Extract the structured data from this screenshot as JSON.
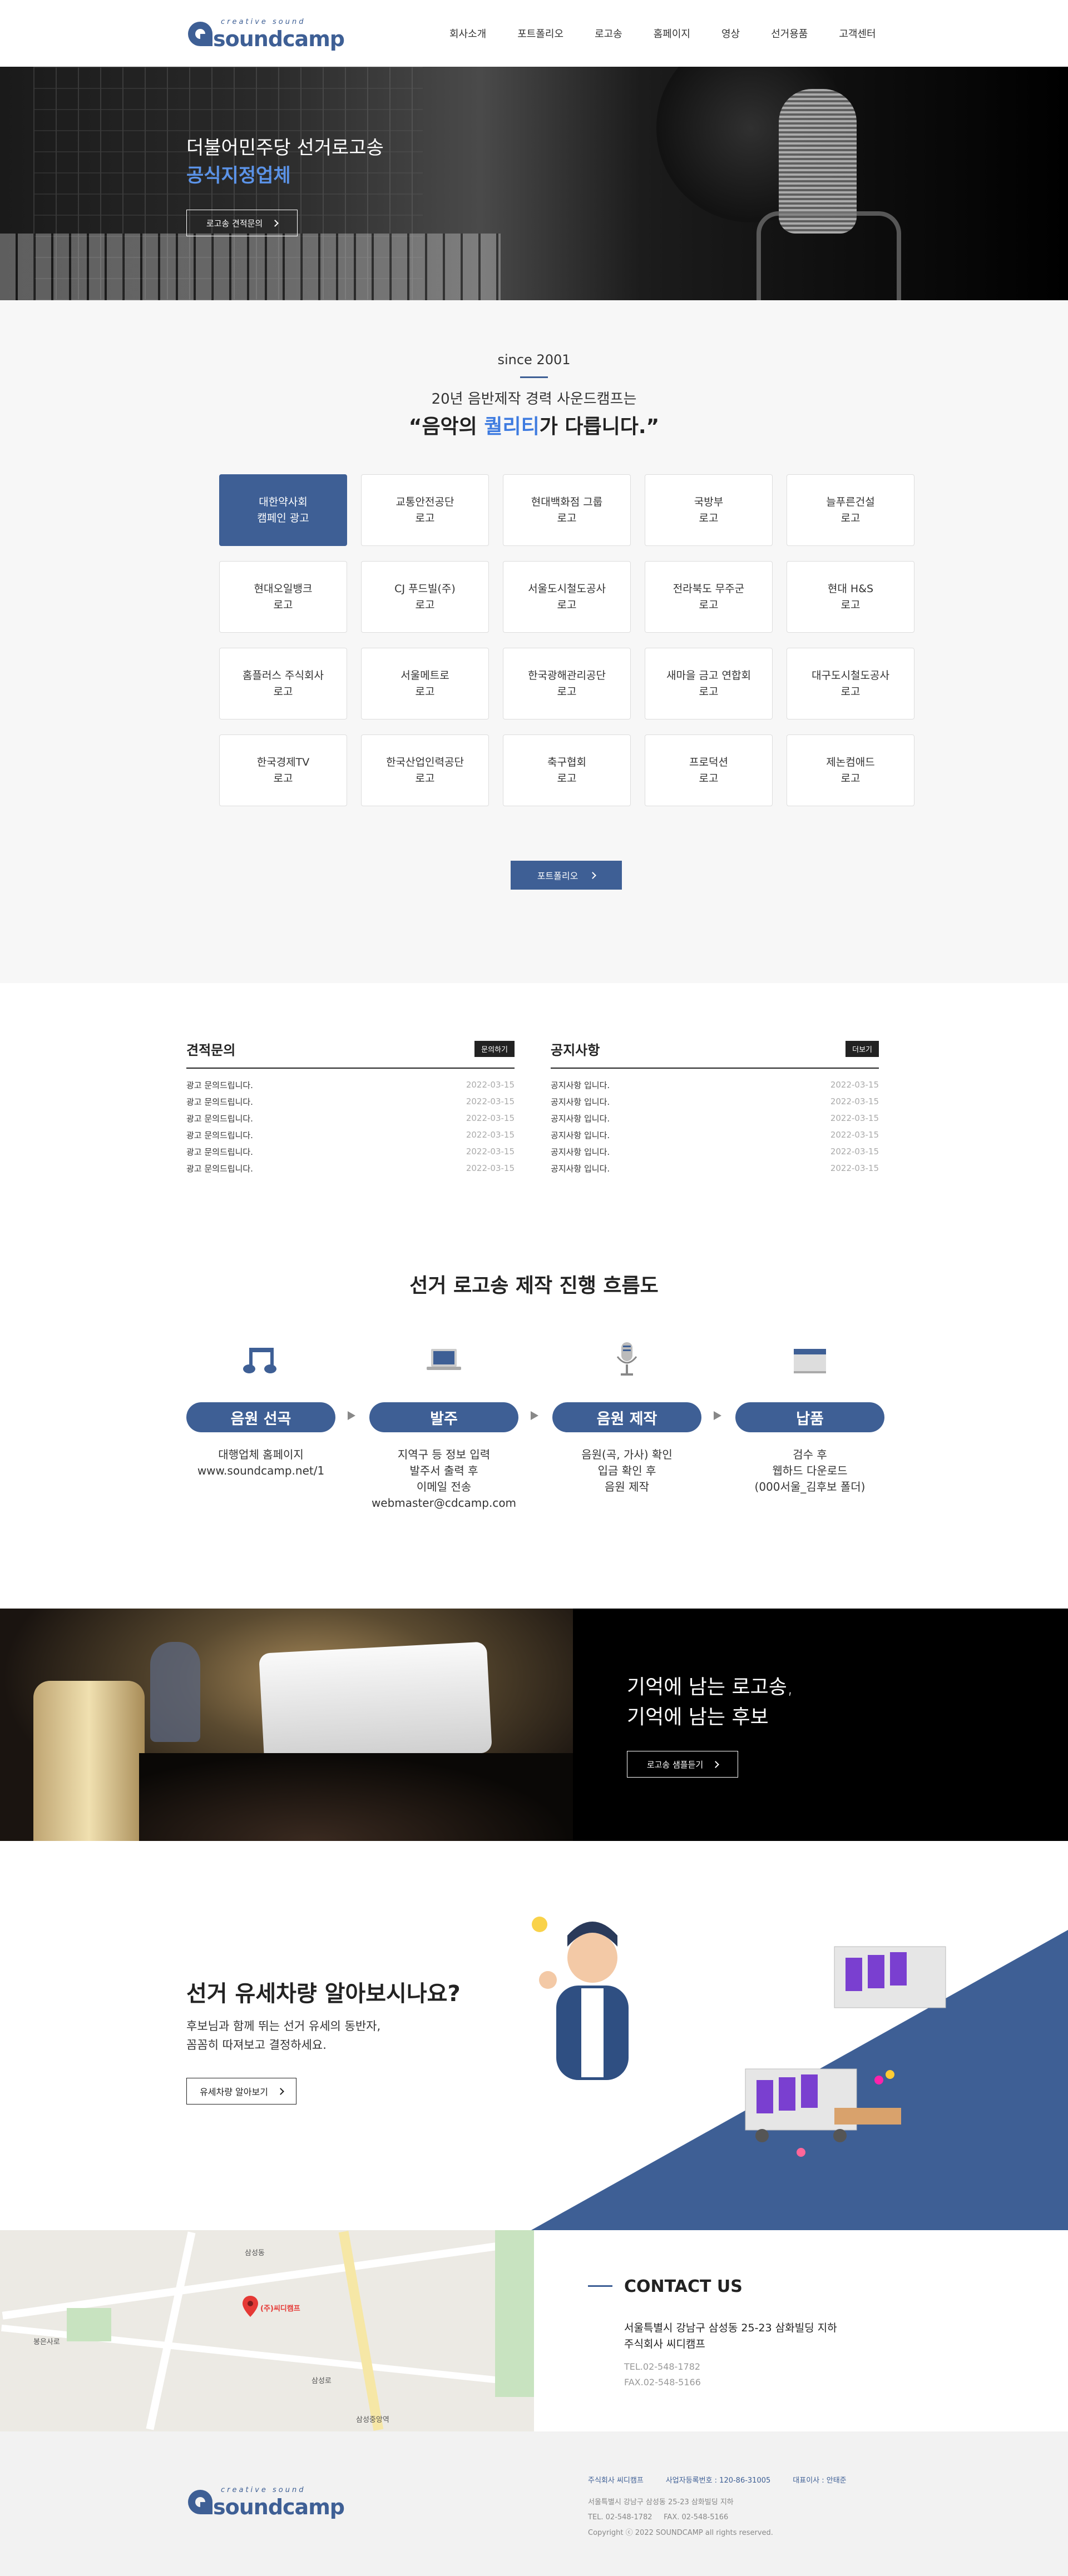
{
  "brand": {
    "sub": "creative sound",
    "name": "soundcamp",
    "color": "#3e5f95"
  },
  "nav": [
    "회사소개",
    "포트폴리오",
    "로고송",
    "홈페이지",
    "영상",
    "선거용품",
    "고객센터"
  ],
  "hero": {
    "title": "더불어민주당 선거로고송",
    "subtitle": "공식지정업체",
    "button": "로고송 견적문의"
  },
  "clients": {
    "since": "since 2001",
    "lead": "20년 음반제작 경력 사운드캠프는",
    "headline_pre": "“음악의 ",
    "headline_accent": "퀄리티",
    "headline_post": "가 다릅니다.”",
    "logos": [
      "대한약사회\n캠페인 광고",
      "교통안전공단\n로고",
      "현대백화점 그룹\n로고",
      "국방부\n로고",
      "늘푸른건설\n로고",
      "현대오일뱅크\n로고",
      "CJ 푸드빌(주)\n로고",
      "서울도시철도공사\n로고",
      "전라북도 무주군\n로고",
      "현대 H&S\n로고",
      "홈플러스 주식회사\n로고",
      "서울메트로\n로고",
      "한국광해관리공단\n로고",
      "새마을 금고 연합회\n로고",
      "대구도시철도공사\n로고",
      "한국경제TV\n로고",
      "한국산업인력공단\n로고",
      "축구협회\n로고",
      "프로덕션\n로고",
      "제논컴애드\n로고"
    ],
    "button": "포트폴리오"
  },
  "estimate": {
    "title": "견적문의",
    "more": "문의하기",
    "items": [
      {
        "text": "광고 문의드립니다.",
        "date": "2022-03-15"
      },
      {
        "text": "광고 문의드립니다.",
        "date": "2022-03-15"
      },
      {
        "text": "광고 문의드립니다.",
        "date": "2022-03-15"
      },
      {
        "text": "광고 문의드립니다.",
        "date": "2022-03-15"
      },
      {
        "text": "광고 문의드립니다.",
        "date": "2022-03-15"
      },
      {
        "text": "광고 문의드립니다.",
        "date": "2022-03-15"
      }
    ]
  },
  "notice": {
    "title": "공지사항",
    "more": "더보기",
    "items": [
      {
        "text": "공지사항 입니다.",
        "date": "2022-03-15"
      },
      {
        "text": "공지사항 입니다.",
        "date": "2022-03-15"
      },
      {
        "text": "공지사항 입니다.",
        "date": "2022-03-15"
      },
      {
        "text": "공지사항 입니다.",
        "date": "2022-03-15"
      },
      {
        "text": "공지사항 입니다.",
        "date": "2022-03-15"
      },
      {
        "text": "공지사항 입니다.",
        "date": "2022-03-15"
      }
    ]
  },
  "process": {
    "title": "선거 로고송 제작 진행 흐름도",
    "steps": [
      {
        "icon": "music-note-icon",
        "label": "음원 선곡",
        "desc": "대행업체 홈페이지\nwww.soundcamp.net/1"
      },
      {
        "icon": "laptop-icon",
        "label": "발주",
        "desc": "지역구 등 정보 입력\n발주서 출력 후\n이메일 전송\nwebmaster@cdcamp.com"
      },
      {
        "icon": "microphone-icon",
        "label": "음원 제작",
        "desc": "음원(곡, 가사) 확인\n입금 확인 후\n음원 제작"
      },
      {
        "icon": "monitor-icon",
        "label": "납품",
        "desc": "검수 후\n웹하드 다운로드\n(000서울_김후보 폴더)"
      }
    ]
  },
  "banner": {
    "text": "기억에 남는 로고송,\n기억에 남는 후보",
    "button": "로고송 샘플듣기"
  },
  "vehicle": {
    "title": "선거 유세차량 알아보시나요?",
    "desc": "후보님과 함께 뛰는 선거 유세의 동반자,\n꼼꼼히 따져보고 결정하세요.",
    "button": "유세차량 알아보기"
  },
  "map": {
    "marker": "(주)씨디캠프",
    "labels": [
      "삼성동",
      "봉은사로",
      "삼성로",
      "삼성중앙역"
    ]
  },
  "contact": {
    "title": "CONTACT US",
    "address": "서울특별시 강남구 삼성동 25-23 삼화빌딩 지하\n주식회사 씨디캠프",
    "tel": "TEL.02-548-1782\nFAX.02-548-5166"
  },
  "footer": {
    "company": "주식회사 씨디캠프",
    "bizno": "사업자등록번호 : 120-86-31005",
    "ceo": "대표이사 : 안태준",
    "address": "서울특별시 강남구 삼성동 25-23 삼화빌딩 지하",
    "tel": "TEL. 02-548-1782     FAX. 02-548-5166",
    "copyright": "Copyright ⓒ 2022 SOUNDCAMP all rights reserved."
  }
}
